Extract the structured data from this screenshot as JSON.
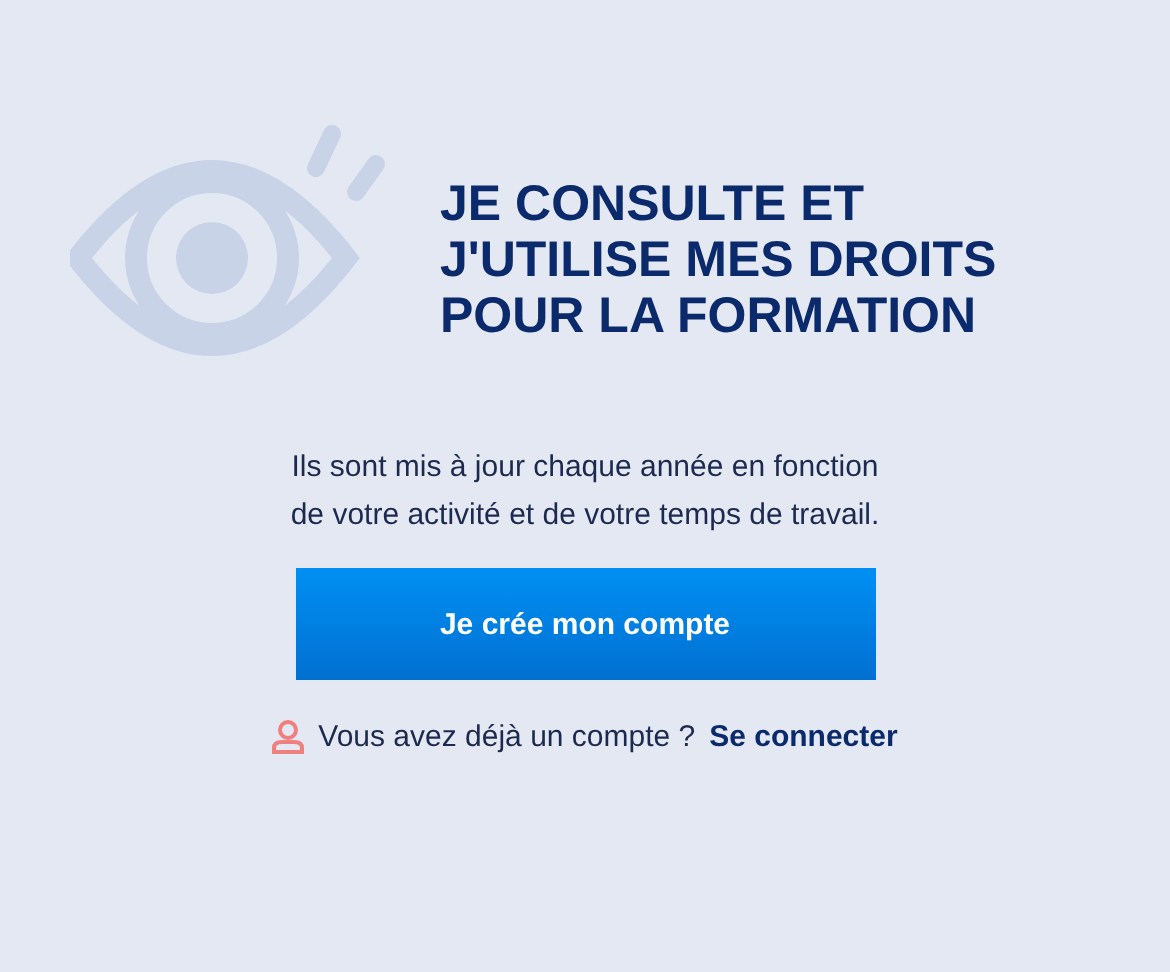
{
  "heading": [
    "JE CONSULTE ET",
    "J'UTILISE MES DROITS",
    "POUR LA FORMATION"
  ],
  "description": "Ils sont mis à jour chaque année en fonction de votre activité et de votre temps de travail.",
  "signup_button": "Je crée mon compte",
  "login_prompt": {
    "text": "Vous avez déjà un compte ?",
    "link": "Se connecter"
  }
}
